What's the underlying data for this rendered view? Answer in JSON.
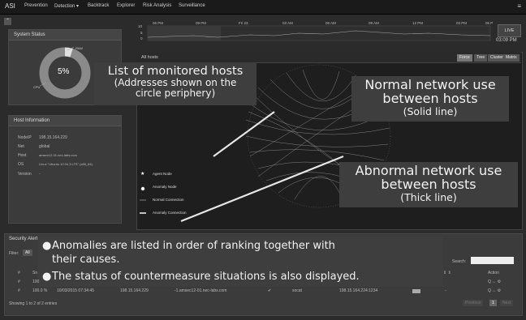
{
  "nav": {
    "brand": "ASI",
    "items": [
      "Prevention",
      "Detection ▾",
      "Backtrack",
      "Explorer",
      "Risk Analysis",
      "Surveillance"
    ]
  },
  "timeline": {
    "labels": [
      "06 PM",
      "09 PM",
      "Fri 23",
      "03 AM",
      "06 AM",
      "09 AM",
      "12 PM",
      "03 PM",
      "06 P"
    ],
    "y_ticks": [
      "10",
      "5",
      "0"
    ],
    "live_label": "LIVE",
    "clock": "03:09 PM"
  },
  "system_status": {
    "title": "System Status",
    "percent": "5%",
    "label_top": "RAM",
    "label_left": "CPU"
  },
  "host_info": {
    "title": "Host Information",
    "rows": [
      {
        "key": "NodeIP",
        "value": "198.15.164.229"
      },
      {
        "key": "Net",
        "value": "global"
      },
      {
        "key": "Host",
        "value": "amsec12-01.nec-labs.com"
      },
      {
        "key": "OS",
        "value": "Linux \"Ubuntu 12.04.3 LTS\" (x86_64)"
      },
      {
        "key": "Version",
        "value": "-"
      }
    ]
  },
  "graph": {
    "title": "All hosts",
    "buttons": [
      "Force",
      "Tree",
      "Cluster",
      "Matrix"
    ],
    "legend": [
      "Agent Node",
      "Anomaly Node",
      "Normal Connection",
      "Anomaly Connection"
    ]
  },
  "callouts": {
    "hosts_line1": "List of monitored hosts",
    "hosts_line2": "(Addresses shown on the",
    "hosts_line3": "circle periphery)",
    "normal_line1": "Normal network use",
    "normal_line2": "between hosts",
    "normal_line3": "(Solid line)",
    "abnormal_line1": "Abnormal network use",
    "abnormal_line2": "between hosts",
    "abnormal_line3": "(Thick line)"
  },
  "alerts": {
    "title": "Security Alerts",
    "filter_label": "Filter:",
    "filter_value": "All",
    "search_label": "Search:",
    "search_value": "",
    "bullet1_line1": "Anomalies are listed in order of ranking together with",
    "bullet1_line2": "their causes.",
    "bullet2": "The status of countermeasure situations is also displayed.",
    "columns": [
      "#",
      "Sn",
      "Action"
    ],
    "rows": [
      {
        "idx": "#",
        "score": "100",
        "actions": "Q ↔ ⚙"
      },
      {
        "idx": "#",
        "score": "100.0 %",
        "time": "10/03/2015 07:34:45",
        "ip": "198.15.164.229",
        "host": "-1.amsec12-01.nec-labs.com",
        "check": "✔",
        "proto": "socat",
        "dest": "198.15.164.224:1234",
        "dash": "-",
        "actions": "Q ↔ ⚙"
      }
    ],
    "showing": "Showing 1 to 2 of 2 entries",
    "previous": "Previous",
    "page": "1",
    "next": "Next"
  }
}
